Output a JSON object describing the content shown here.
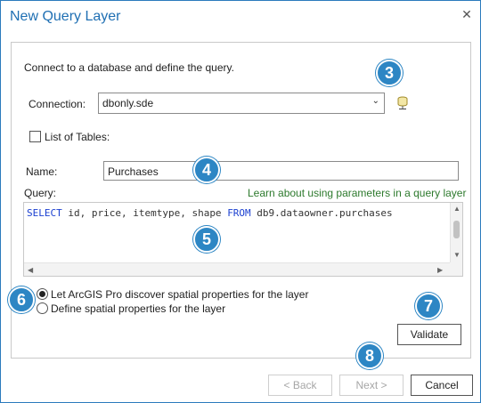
{
  "window": {
    "title": "New Query Layer",
    "close_icon": "close-icon"
  },
  "intro_text": "Connect to a database and define the query.",
  "connection": {
    "label": "Connection:",
    "value": "dbonly.sde",
    "icon": "database-connection-icon"
  },
  "list_of_tables": {
    "label": "List of Tables:",
    "checked": false
  },
  "name": {
    "label": "Name:",
    "value": "Purchases"
  },
  "query": {
    "label": "Query:",
    "help_link": "Learn about using parameters in a query layer",
    "sql": {
      "kw1": "SELECT",
      "part1": " id, price, itemtype, shape ",
      "kw2": "FROM",
      "part2": " db9.dataowner.purchases"
    }
  },
  "spatial_options": {
    "option1": {
      "label": "Let ArcGIS Pro discover spatial properties for the layer",
      "selected": true
    },
    "option2": {
      "label": "Define spatial properties for the layer",
      "selected": false
    }
  },
  "buttons": {
    "validate": "Validate",
    "back": "< Back",
    "next": "Next >",
    "cancel": "Cancel"
  },
  "callouts": {
    "c3": "3",
    "c4": "4",
    "c5": "5",
    "c6": "6",
    "c7": "7",
    "c8": "8"
  },
  "colors": {
    "accent": "#2d86c4",
    "title": "#1f6fb3",
    "link": "#2d7a2d",
    "sql_keyword": "#1a3fd0"
  }
}
